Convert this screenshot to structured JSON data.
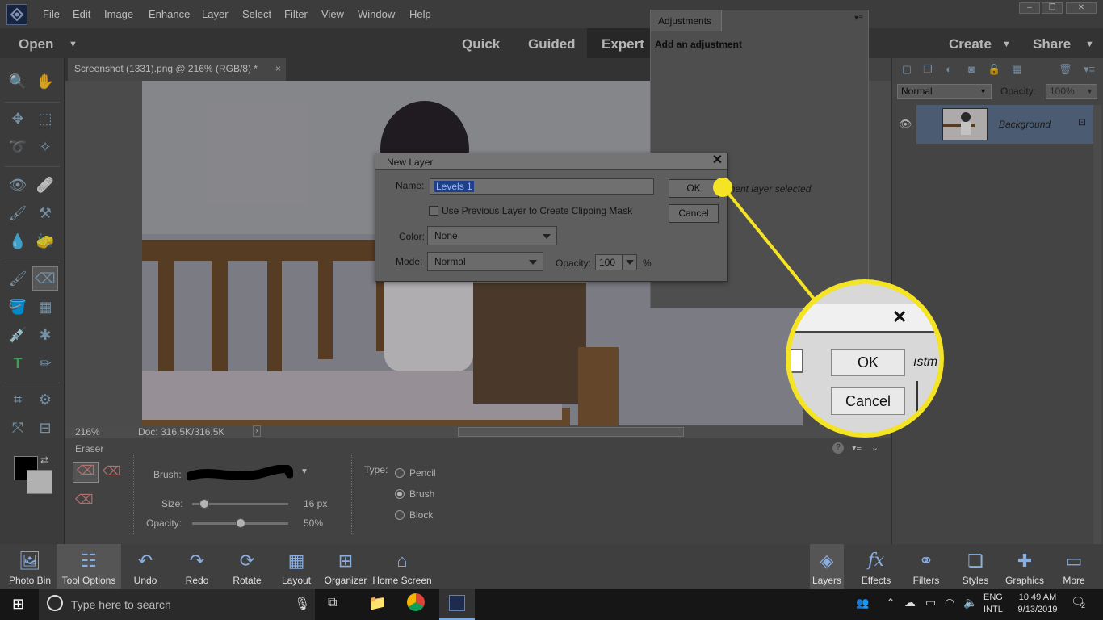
{
  "menubar": {
    "items": [
      "File",
      "Edit",
      "Image",
      "Enhance",
      "Layer",
      "Select",
      "Filter",
      "View",
      "Window",
      "Help"
    ],
    "window_controls": [
      "–",
      "❐",
      "✕"
    ]
  },
  "modebar": {
    "open_label": "Open",
    "tabs": [
      "Quick",
      "Guided",
      "Expert"
    ],
    "create_label": "Create",
    "share_label": "Share"
  },
  "document": {
    "tab_title": "Screenshot (1331).png @ 216% (RGB/8) *",
    "tab_close": "×"
  },
  "statusbar": {
    "zoom": "216%",
    "doc_info": "Doc: 316.5K/316.5K"
  },
  "options": {
    "tool_name": "Eraser",
    "brush_label": "Brush:",
    "size_label": "Size:",
    "size_value": "16 px",
    "size_level": 0.08,
    "opacity_label": "Opacity:",
    "opacity_value": "50%",
    "opacity_level": 0.5,
    "type_label": "Type:",
    "types": [
      "Pencil",
      "Brush",
      "Block"
    ],
    "selected_type": "Brush"
  },
  "adjustments": {
    "tab_label": "Adjustments",
    "title": "Add an adjustment",
    "status_text": "stment layer selected"
  },
  "layers": {
    "blend_mode": "Normal",
    "opacity_label": "Opacity:",
    "opacity_value": "100%",
    "layer_name": "Background"
  },
  "dialog": {
    "title": "New Layer",
    "name_label": "Name:",
    "name_value": "Levels 1",
    "clip_label": "Use Previous Layer to Create Clipping Mask",
    "color_label": "Color:",
    "color_value": "None",
    "mode_label": "Mode:",
    "mode_value": "Normal",
    "opacity_label": "Opacity:",
    "opacity_value": "100",
    "opacity_unit": "%",
    "ok_label": "OK",
    "cancel_label": "Cancel"
  },
  "callout": {
    "ok_label": "OK",
    "cancel_label": "Cancel",
    "partial_text": "ıstm",
    "accent_color": "#f4e423"
  },
  "bottombar": {
    "left_items": [
      {
        "label": "Photo Bin",
        "icon": "photo-bin-icon"
      },
      {
        "label": "Tool Options",
        "icon": "tool-options-icon"
      },
      {
        "label": "Undo",
        "icon": "undo-icon"
      },
      {
        "label": "Redo",
        "icon": "redo-icon"
      },
      {
        "label": "Rotate",
        "icon": "rotate-icon"
      },
      {
        "label": "Layout",
        "icon": "layout-icon"
      },
      {
        "label": "Organizer",
        "icon": "organizer-icon"
      },
      {
        "label": "Home Screen",
        "icon": "home-icon"
      }
    ],
    "right_items": [
      {
        "label": "Layers",
        "icon": "layers-icon"
      },
      {
        "label": "Effects",
        "icon": "effects-icon"
      },
      {
        "label": "Filters",
        "icon": "filters-icon"
      },
      {
        "label": "Styles",
        "icon": "styles-icon"
      },
      {
        "label": "Graphics",
        "icon": "graphics-icon"
      },
      {
        "label": "More",
        "icon": "more-icon"
      }
    ]
  },
  "taskbar": {
    "search_placeholder": "Type here to search",
    "lang_top": "ENG",
    "lang_bottom": "INTL",
    "time": "10:49 AM",
    "date": "9/13/2019",
    "notification_count": "2"
  }
}
